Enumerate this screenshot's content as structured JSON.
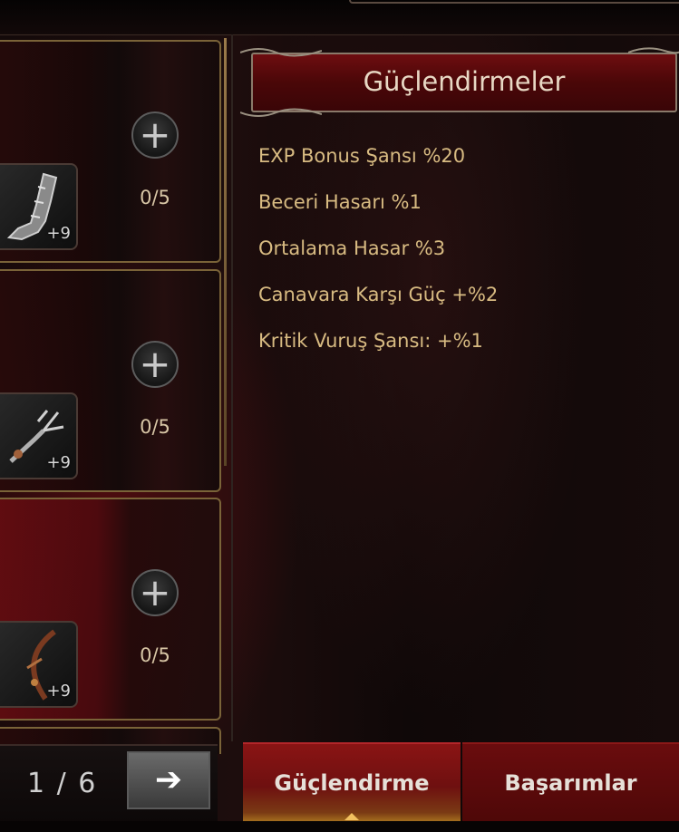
{
  "panel": {
    "title": "Güçlendirmeler",
    "bonuses": [
      "EXP Bonus Şansı %20",
      "Beceri Hasarı %1",
      "Ortalama Hasar %3",
      "Canavara Karşı Güç +%2",
      "Kritik Vuruş Şansı: +%1"
    ]
  },
  "slots": [
    {
      "item_level": "+9",
      "count": "0/5",
      "icon": "plus-icon"
    },
    {
      "item_level": "+9",
      "count": "0/5",
      "icon": "plus-icon"
    },
    {
      "item_level": "+9",
      "count": "0/5",
      "icon": "plus-icon"
    }
  ],
  "pagination": {
    "page": "1 / 6",
    "next_icon": "arrow-right-icon"
  },
  "tabs": {
    "active": "Güçlendirme",
    "inactive": "Başarımlar"
  },
  "colors": {
    "gold_text": "#d8bb82",
    "title_red": "#6e0d10",
    "frame_gold": "#7a6338"
  }
}
